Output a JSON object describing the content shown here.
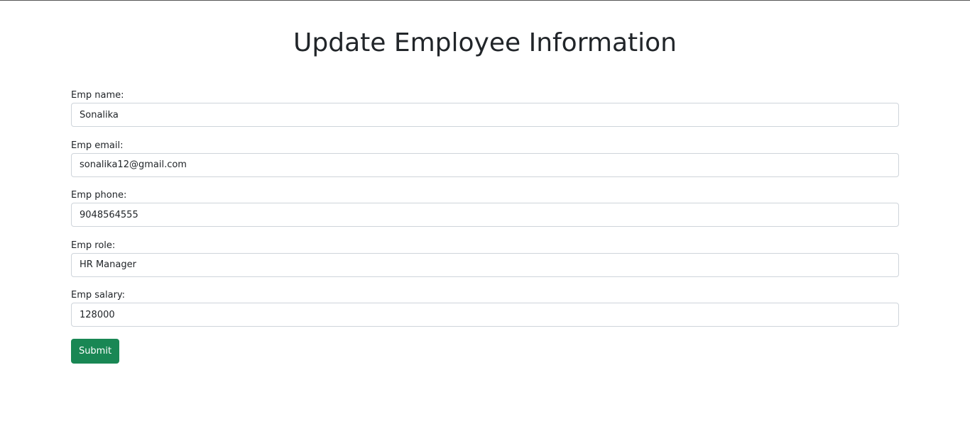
{
  "page": {
    "title": "Update Employee Information"
  },
  "form": {
    "fields": [
      {
        "label": "Emp name:",
        "value": "Sonalika"
      },
      {
        "label": "Emp email:",
        "value": "sonalika12@gmail.com"
      },
      {
        "label": "Emp phone:",
        "value": "9048564555"
      },
      {
        "label": "Emp role:",
        "value": "HR Manager"
      },
      {
        "label": "Emp salary:",
        "value": "128000"
      }
    ],
    "submit_label": "Submit"
  },
  "colors": {
    "submit_button": "#198754",
    "input_border": "#ced4da",
    "text": "#212529"
  }
}
